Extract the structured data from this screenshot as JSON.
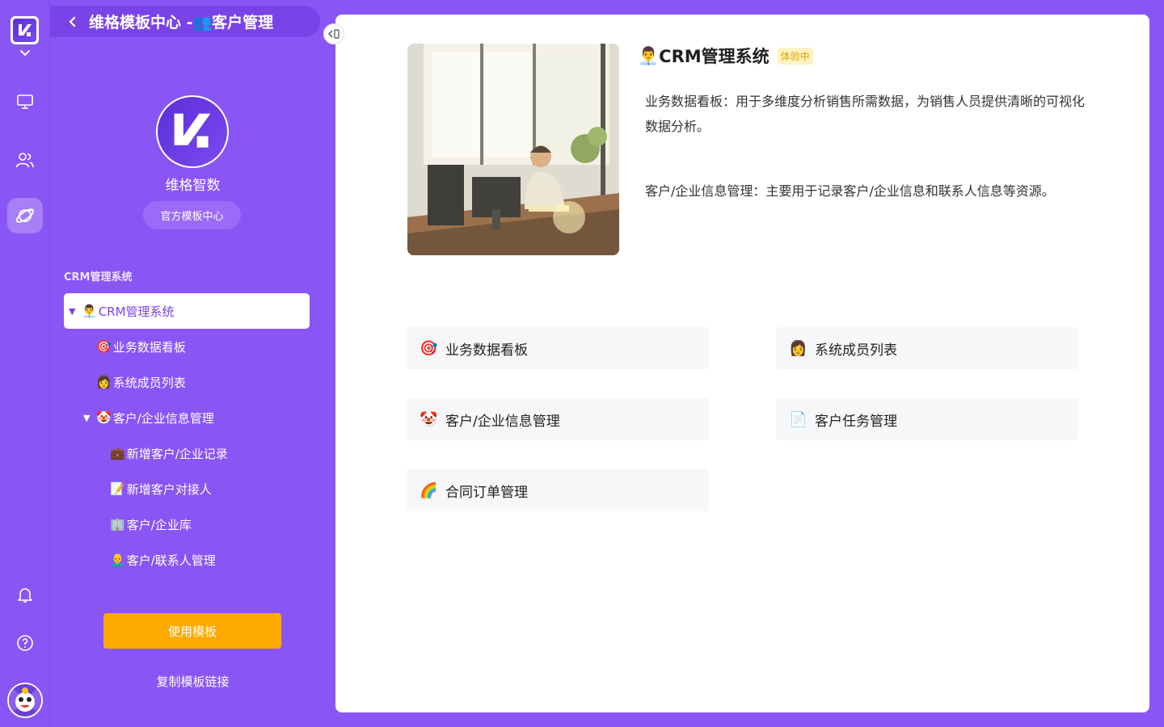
{
  "rail": {
    "icons": [
      "logo-icon",
      "chevron-down-icon",
      "monitor-icon",
      "users-icon",
      "planet-icon",
      "bell-icon",
      "help-icon"
    ]
  },
  "sidebar": {
    "header_title": "维格模板中心 -👥客户管理",
    "org_name": "维格智数",
    "org_badge": "官方模板中心",
    "tree_title": "CRM管理系统",
    "tree": [
      {
        "indent": 0,
        "arrow": "▼",
        "emoji": "👨‍💼",
        "label": "CRM管理系统",
        "selected": true
      },
      {
        "indent": 1,
        "arrow": "",
        "emoji": "🎯",
        "label": "业务数据看板"
      },
      {
        "indent": 1,
        "arrow": "",
        "emoji": "👩",
        "label": "系统成员列表"
      },
      {
        "indent": 1,
        "arrow": "▼",
        "emoji": "🤡",
        "label": "客户/企业信息管理"
      },
      {
        "indent": 2,
        "arrow": "",
        "emoji": "💼",
        "label": "新增客户/企业记录"
      },
      {
        "indent": 2,
        "arrow": "",
        "emoji": "📝",
        "label": "新增客户对接人"
      },
      {
        "indent": 2,
        "arrow": "",
        "emoji": "🏢",
        "label": "客户/企业库"
      },
      {
        "indent": 2,
        "arrow": "",
        "emoji": "👨‍🦲",
        "label": "客户/联系人管理"
      }
    ],
    "use_button": "使用模板",
    "copy_link": "复制模板链接"
  },
  "main": {
    "title_emoji": "👨‍💼",
    "title": "CRM管理系统",
    "trial_badge": "体验中",
    "desc1": "业务数据看板：用于多维度分析销售所需数据，为销售人员提供清晰的可视化数据分析。",
    "desc2": "客户/企业信息管理：主要用于记录客户/企业信息和联系人信息等资源。",
    "cards": [
      {
        "emoji": "🎯",
        "label": "业务数据看板"
      },
      {
        "emoji": "👩",
        "label": "系统成员列表"
      },
      {
        "emoji": "🤡",
        "label": "客户/企业信息管理"
      },
      {
        "emoji": "📄",
        "label": "客户任务管理"
      },
      {
        "emoji": "🌈",
        "label": "合同订单管理"
      }
    ]
  },
  "colors": {
    "brand": "#8a55f5",
    "selected_text": "#7a43e8",
    "use_button": "#ffaa00",
    "trial_badge_bg": "#fff3c4"
  }
}
